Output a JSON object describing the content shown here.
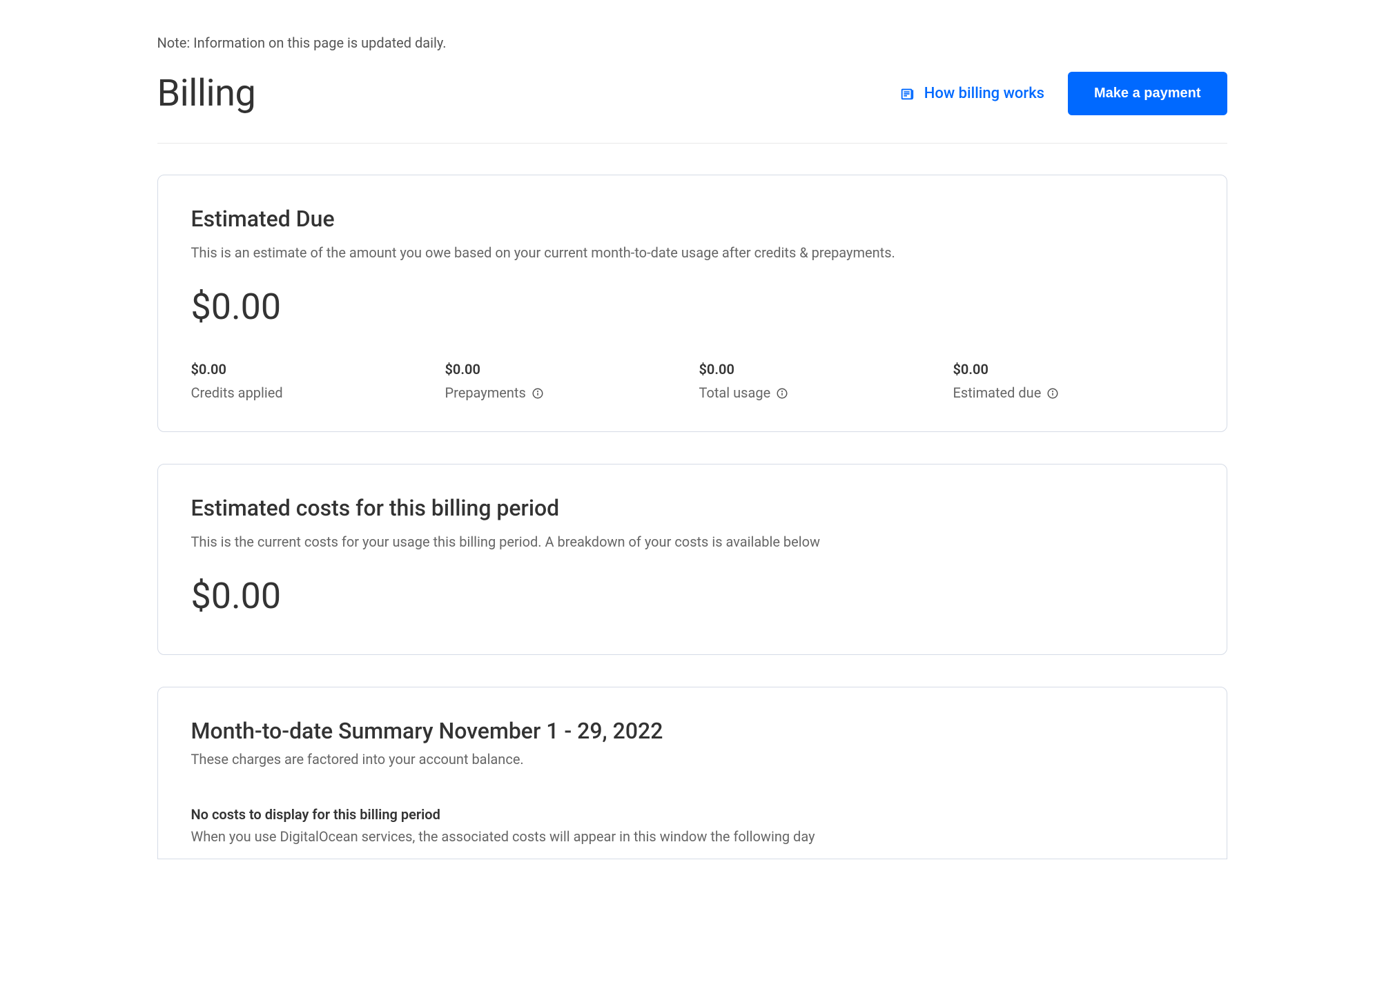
{
  "note": "Note: Information on this page is updated daily.",
  "header": {
    "title": "Billing",
    "howBillingWorks": "How billing works",
    "makePayment": "Make a payment"
  },
  "estimatedDue": {
    "title": "Estimated Due",
    "subtitle": "This is an estimate of the amount you owe based on your current month-to-date usage after credits & prepayments.",
    "amount": "$0.00",
    "stats": [
      {
        "value": "$0.00",
        "label": "Credits applied",
        "hasInfo": false
      },
      {
        "value": "$0.00",
        "label": "Prepayments",
        "hasInfo": true
      },
      {
        "value": "$0.00",
        "label": "Total usage",
        "hasInfo": true
      },
      {
        "value": "$0.00",
        "label": "Estimated due",
        "hasInfo": true
      }
    ]
  },
  "estimatedCosts": {
    "title": "Estimated costs for this billing period",
    "subtitle": "This is the current costs for your usage this billing period. A breakdown of your costs is available below",
    "amount": "$0.00"
  },
  "summary": {
    "title": "Month-to-date Summary November 1 - 29, 2022",
    "subtitle": "These charges are factored into your account balance.",
    "noCostsTitle": "No costs to display for this billing period",
    "noCostsDesc": "When you use DigitalOcean services, the associated costs will appear in this window the following day"
  }
}
